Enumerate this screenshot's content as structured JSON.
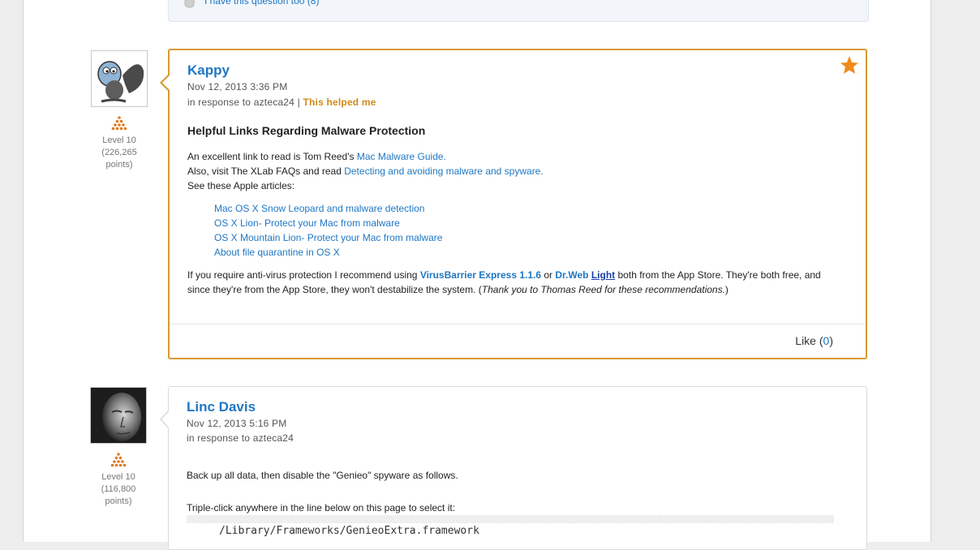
{
  "question_box": {
    "link_label": "I have this question too",
    "count": "8"
  },
  "posts": [
    {
      "author": "Kappy",
      "date": "Nov 12, 2013 3:36 PM",
      "in_response_prefix": "in response to",
      "in_response_user": "azteca24",
      "separator": "|",
      "helped": "This helped me",
      "level": "Level 10",
      "points": "(226,265",
      "points_suffix": "points)",
      "heading": "Helpful Links Regarding Malware Protection",
      "p1_text": "An excellent link to read is Tom Reed's ",
      "p1_link": "Mac Malware Guide.",
      "p2_text": "Also, visit The XLab FAQs and read ",
      "p2_link": "Detecting and avoiding malware and spyware.",
      "p3_text": "See these Apple articles:",
      "articles": [
        "Mac OS X Snow Leopard and malware detection",
        "OS X Lion- Protect your Mac from malware",
        "OS X Mountain Lion- Protect your Mac from malware",
        "About file quarantine in OS X"
      ],
      "p4_a": "If you require anti-virus protection I recommend using ",
      "p4_link1": "VirusBarrier Express 1.1.6",
      "p4_or": " or ",
      "p4_link2": "Dr.Web",
      "p4_link3": "Light",
      "p4_b": " both from the App Store. They're both free, and since they're from the App Store, they won't destabilize the system. (",
      "p4_italic": "Thank you to Thomas Reed for these recommendations.",
      "p4_end": ")",
      "like_label": "Like",
      "like_count": "0",
      "accent": "#d69a32"
    },
    {
      "author": "Linc Davis",
      "date": "Nov 12, 2013 5:16 PM",
      "in_response_prefix": "in response to",
      "in_response_user": "azteca24",
      "level": "Level 10",
      "points": "(116,800",
      "points_suffix": "points)",
      "p1": "Back up all data, then disable the \"Genieo\" spyware as follows.",
      "p2": "Triple-click anywhere in the line below on this page to select it:",
      "code": "/Library/Frameworks/GenieoExtra.framework"
    }
  ],
  "colors": {
    "link": "#1f77c3",
    "helped": "#d08a1c",
    "rank": "#e07b22"
  }
}
